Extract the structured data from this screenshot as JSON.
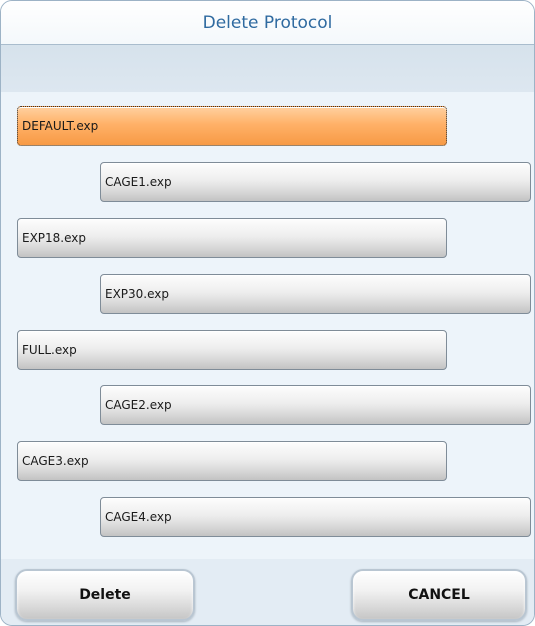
{
  "dialog": {
    "title": "Delete Protocol"
  },
  "protocols": [
    {
      "label": "DEFAULT.exp",
      "selected": true
    },
    {
      "label": "CAGE1.exp",
      "selected": false
    },
    {
      "label": "EXP18.exp",
      "selected": false
    },
    {
      "label": "EXP30.exp",
      "selected": false
    },
    {
      "label": "FULL.exp",
      "selected": false
    },
    {
      "label": "CAGE2.exp",
      "selected": false
    },
    {
      "label": "CAGE3.exp",
      "selected": false
    },
    {
      "label": "CAGE4.exp",
      "selected": false
    }
  ],
  "buttons": {
    "delete_label": "Delete",
    "cancel_label": "CANCEL"
  },
  "colors": {
    "selected": "#f79a45",
    "title_text": "#2f6aa0"
  }
}
